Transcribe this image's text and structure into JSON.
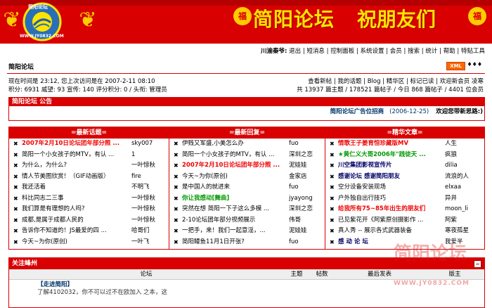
{
  "banner": {
    "logo_text": "简阳论坛",
    "logo_url": "WWW.JY0832.COM",
    "title": "简阳论坛",
    "subtitle": "祝朋友们",
    "fu": "福"
  },
  "nav": {
    "user": "川渝秦爷:",
    "items": [
      "退出",
      "短消息",
      "控制面板",
      "系统设置",
      "会员",
      "搜索",
      "统计",
      "帮助",
      "特贴工具"
    ]
  },
  "crumb": "简阳论坛",
  "xml_label": "XML",
  "arrows": "♦♦♦",
  "info": {
    "line1": "现在时间是 23:12, 您上次访问是在 2007-2-11 08:10",
    "line2": "积分: 6931 威望: 93 宣传: 140 评分积分: 0 / 头衔: 管理员",
    "links": "查看新帖 | 我的话题 | Blog | 精华区 | 标记已读 | 欢迎新会员 凌寒",
    "stats": "共 13937 篇主题 / 178521 篇帖子 / 今日 868 篇帖子 / 4401 位会员"
  },
  "announce": {
    "head": "简阳论坛 公告",
    "title": "简阳论坛广告位招商",
    "date": "(2006-12-25)",
    "last": "欢迎您带新思路:)"
  },
  "columns": [
    {
      "title": "=最新话题=",
      "rows": [
        {
          "t": "2007年2月10日论坛团年部分照 ...",
          "a": "sky007",
          "style": "red"
        },
        {
          "t": "简阳一个小女孩子的MTV，有认 ...",
          "a": "1",
          "style": ""
        },
        {
          "t": "为什么，为什么?",
          "a": "一叶惊秋",
          "style": ""
        },
        {
          "t": "情人节美图欣赏！（GIF动画版）",
          "a": "fire",
          "style": ""
        },
        {
          "t": "我还活着",
          "a": "不明飞",
          "style": ""
        },
        {
          "t": "科比同志二三事",
          "a": "一叶惊秋",
          "style": ""
        },
        {
          "t": "我们算是有理想的人吗?",
          "a": "一叶惊秋",
          "style": ""
        },
        {
          "t": "成都,是属于成都人民的",
          "a": "一叶惊秋",
          "style": ""
        },
        {
          "t": "告诉你不知道的！JS最爱的四 ...",
          "a": "哈哥们",
          "style": ""
        },
        {
          "t": "今天~为你(原创)",
          "a": "一叶飞",
          "style": ""
        }
      ]
    },
    {
      "title": "=最新回复=",
      "rows": [
        {
          "t": "伊贱又军盛,小美怎么办",
          "a": "fuo",
          "style": ""
        },
        {
          "t": "简阳一个小女孩子的MTV，有认 ...",
          "a": "深圳之恋",
          "style": ""
        },
        {
          "t": "2007年2月10日论坛团年部分照 ...",
          "a": "泥娃娃",
          "style": "red"
        },
        {
          "t": "今天~为你(原创)",
          "a": "金家店",
          "style": ""
        },
        {
          "t": "是中国人的就进来",
          "a": "fuo",
          "style": ""
        },
        {
          "t": "你让我感动[舞曲]",
          "a": "jyayong",
          "style": "green"
        },
        {
          "t": "突然在想 简阳一下子这么多模 ...",
          "a": "深圳之恋",
          "style": ""
        },
        {
          "t": "2-10论坛团年部分视频展示",
          "a": "伟哥",
          "style": ""
        },
        {
          "t": "一把手，来！我们一起意淫，...",
          "a": "泥娃娃",
          "style": ""
        },
        {
          "t": "简阳鳗鱼11月1日开张?",
          "a": "fuo",
          "style": ""
        }
      ]
    },
    {
      "title": "=精华文章=",
      "rows": [
        {
          "t": "情歌王子姜育恒珍藏版MV",
          "a": "人生",
          "style": "red"
        },
        {
          "t": "★黄仁义大哥2006年\"践徒天 ...",
          "a": "疯狼",
          "style": "green"
        },
        {
          "t": "川空集团影视宣传片",
          "a": "dilia",
          "style": "blue"
        },
        {
          "t": "感谢论坛 感谢简阳朋友",
          "a": "流浪的人",
          "style": "blue"
        },
        {
          "t": "空分设备安装现场",
          "a": "elxaa",
          "style": ""
        },
        {
          "t": "户外独自出行技巧",
          "a": "异井",
          "style": ""
        },
        {
          "t": "给我所有75~85年出生的朋友们",
          "a": "moon_li",
          "style": "red"
        },
        {
          "t": "已见紫花开《阿紫原创摄影作 ...",
          "a": "阿紫",
          "style": ""
        },
        {
          "t": "真人秀 -- 展示各式武器装备",
          "a": "寒夜孤星",
          "style": ""
        },
        {
          "t": "感 动 论 坛",
          "a": "我爱半",
          "style": "blue"
        }
      ]
    }
  ],
  "forum": {
    "head": "关注峰州",
    "minus": "−",
    "columns": [
      "论坛",
      "主题",
      "帖数",
      "最后发表",
      "版主"
    ],
    "first_name": "【走进简阳】",
    "first_desc": "了解4102032，你不可以过不在欧加入 之本，这"
  },
  "watermark": "简阳论坛",
  "watermark_url": "WWW.JY0832.COM"
}
